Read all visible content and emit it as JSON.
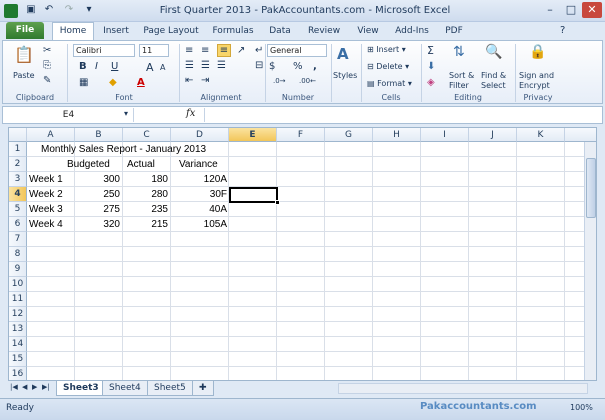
{
  "window": {
    "title": "First Quarter 2013 - PakAccountants.com - Microsoft Excel"
  },
  "tabs": [
    "File",
    "Home",
    "Insert",
    "Page Layout",
    "Formulas",
    "Data",
    "Review",
    "View",
    "Add-Ins",
    "PDF"
  ],
  "ribbon": {
    "clipboard": {
      "label": "Clipboard",
      "paste": "Paste"
    },
    "font": {
      "label": "Font",
      "name": "Calibri",
      "size": "11",
      "bold": "B",
      "italic": "I",
      "underline": "U",
      "grow": "A",
      "shrink": "A"
    },
    "alignment": {
      "label": "Alignment"
    },
    "number": {
      "label": "Number",
      "format": "General",
      "currency": "$",
      "percent": "%",
      "comma": ","
    },
    "styles": {
      "label": "Styles"
    },
    "cells": {
      "label": "Cells",
      "insert": "Insert",
      "delete": "Delete",
      "format": "Format"
    },
    "editing": {
      "label": "Editing",
      "sum": "Σ",
      "sort": "Sort &",
      "sort2": "Filter",
      "find": "Find &",
      "find2": "Select"
    },
    "privacy": {
      "label": "Privacy",
      "sign": "Sign and",
      "sign2": "Encrypt"
    }
  },
  "formula_bar": {
    "name_box": "E4",
    "fx": "fx",
    "formula": ""
  },
  "columns": [
    "A",
    "B",
    "C",
    "D",
    "E",
    "F",
    "G",
    "H",
    "I",
    "J",
    "K"
  ],
  "rows": [
    "1",
    "2",
    "3",
    "4",
    "5",
    "6",
    "7",
    "8",
    "9",
    "10",
    "11",
    "12",
    "13",
    "14",
    "15",
    "16"
  ],
  "cells": {
    "A1": "Monthly Sales Report - January 2013",
    "B2": "Budgeted",
    "C2": "Actual",
    "D2": "Variance",
    "A3": "Week 1",
    "B3": "300",
    "C3": "180",
    "D3": "120A",
    "A4": "Week 2",
    "B4": "250",
    "C4": "280",
    "D4": "30F",
    "A5": "Week 3",
    "B5": "275",
    "C5": "235",
    "D5": "40A",
    "A6": "Week 4",
    "B6": "320",
    "C6": "215",
    "D6": "105A"
  },
  "sheets": [
    "Sheet3",
    "Sheet4",
    "Sheet5"
  ],
  "status": {
    "ready": "Ready",
    "watermark": "Pakaccountants.com",
    "zoom": "100%"
  }
}
